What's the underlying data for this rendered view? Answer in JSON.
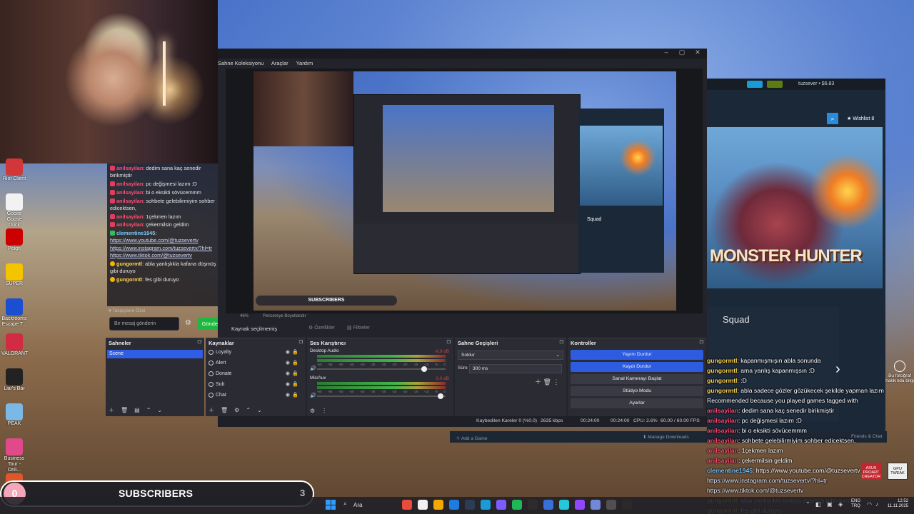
{
  "desktop_icons": [
    {
      "label": "Riot Client",
      "icon": "riot-client-icon",
      "color": "#d13639"
    },
    {
      "label": "Goose Goose Duck",
      "icon": "goose-icon",
      "color": "#f2f2f2"
    },
    {
      "label": "Peign",
      "icon": "peign-icon",
      "color": "#cc0000"
    },
    {
      "label": "SUPER",
      "icon": "super-icon",
      "color": "#f5c400"
    },
    {
      "label": "Backrooms Escape T...",
      "icon": "backrooms-icon",
      "color": "#1a4fd1"
    },
    {
      "label": "VALORANT",
      "icon": "valorant-icon",
      "color": "#d22b43"
    },
    {
      "label": "Liar's Bar",
      "icon": "liars-bar-icon",
      "color": "#222222"
    },
    {
      "label": "PEAK",
      "icon": "peak-icon",
      "color": "#7cb8e6"
    },
    {
      "label": "Business Tour - Onli...",
      "icon": "business-tour-icon",
      "color": "#e04a8a"
    },
    {
      "label": "",
      "icon": "app-icon",
      "color": "#e1552b"
    }
  ],
  "chat_left": {
    "messages": [
      {
        "user": "anilsayilan",
        "role": "user",
        "text": ": dedim sana kaç senedir birikmiştir"
      },
      {
        "user": "anilsayilan",
        "role": "user",
        "text": ": pc değişmesi lazım :D"
      },
      {
        "user": "anilsayilan",
        "role": "user",
        "text": ": bi o eksikti sövücemmm"
      },
      {
        "user": "anilsayilan",
        "role": "user",
        "text": ": sohbete gelebilirmiyim sohber edicektsen,"
      },
      {
        "user": "anilsayilan",
        "role": "user",
        "text": ": 1çekmen lazım"
      },
      {
        "user": "anilsayilan",
        "role": "user",
        "text": ": çekermilsin geldim"
      },
      {
        "user": "clementine1945",
        "role": "bot",
        "text": ":",
        "links": [
          "https://www.youtube.com/@tuzsevertv",
          "https://www.instagram.com/tuzsevertv/?hl=tr",
          "https://www.tiktok.com/@tuzsevertv"
        ]
      },
      {
        "user": "gungormtl",
        "role": "mod",
        "text": ": abla yanlışlıkla kafana düşmüş gibi duruyo"
      },
      {
        "user": "gungormtl",
        "role": "mod",
        "text": ": fes gibi duruyo"
      }
    ],
    "follower_note": "♥ Takipçilere Özel",
    "input_placeholder": "Bir mesaj gönderin",
    "send_label": "Gönder"
  },
  "obs": {
    "menu": [
      "Sahne Koleksiyonu",
      "Araçlar",
      "Yardım"
    ],
    "zoom": "46%",
    "window_projector": "Pencereye Boyutlandır",
    "no_source": "Kaynak seçilmemiş",
    "properties_label": "Özellikler",
    "filters_label": "Filtreler",
    "preview_subscribers": "SUBSCRIBERS",
    "preview_squad": "Squad",
    "docks": {
      "scenes": {
        "title": "Sahneler",
        "items": [
          "Scene"
        ]
      },
      "sources": {
        "title": "Kaynaklar",
        "items": [
          "Loyalty",
          "Alert",
          "Donate",
          "Sub",
          "Chat"
        ]
      },
      "mixer": {
        "title": "Ses Karıştırıcı",
        "channels": [
          {
            "name": "Desktop Audio",
            "db": "-8.9 dB",
            "level": 0.85
          },
          {
            "name": "Mic/Aux",
            "db": "0.0 dB",
            "level": 0.98
          }
        ],
        "ticks": [
          "-60",
          "-55",
          "-50",
          "-45",
          "-40",
          "-35",
          "-30",
          "-25",
          "-20",
          "-15",
          "-10",
          "-5",
          "0"
        ]
      },
      "transitions": {
        "title": "Sahne Geçişleri",
        "type": "Soldur",
        "duration_label": "Süre",
        "duration": "300 ms"
      },
      "controls": {
        "title": "Kontroller",
        "buttons": [
          "Yayını Durdur",
          "Kaydı Durdur",
          "Sanal Kamerayı Başlat",
          "Stüdyo Modu",
          "Ayarlar"
        ]
      }
    },
    "status": {
      "dropped": "Kaybedilen Kareler 0 (%0.0)",
      "bitrate": "2635 kbps",
      "stream_time": "00:24:00",
      "rec_time": "00:24:00",
      "cpu": "CPU: 2.6%",
      "fps": "60.00 / 60.00 FPS"
    }
  },
  "steam": {
    "user": "tuzsever • $6.83",
    "wishlist": "Wishlist",
    "wishlist_count": "8",
    "game_logo": "MONSTER HUNTER",
    "squad_title": "Squad",
    "add_game": "Add a Game",
    "manage_downloads": "Manage Downloads",
    "friends_chat": "Friends & Chat"
  },
  "chat_right": [
    {
      "user": "gungormtl",
      "role": "mod",
      "text": ": kapanmışmışın abla sonunda"
    },
    {
      "user": "gungormtl",
      "role": "mod",
      "text": ": ama yanlış kapanmışsın :D"
    },
    {
      "user": "gungormtl",
      "role": "mod",
      "text": ": :D"
    },
    {
      "user": "gungormtl",
      "role": "mod",
      "text": ": abla sadece gözler gözükecek şekilde yapman lazım"
    },
    {
      "user": "",
      "role": "none",
      "text": "Recommended because you played games tagged with"
    },
    {
      "user": "anilsayilan",
      "role": "user",
      "text": ": dedim sana kaç senedir birikmiştir"
    },
    {
      "user": "anilsayilan",
      "role": "user",
      "text": ": pc değişmesi lazım :D"
    },
    {
      "user": "anilsayilan",
      "role": "user",
      "text": ": bi o eksikti sövücemmm"
    },
    {
      "user": "anilsayilan",
      "role": "user",
      "text": ": sohbete gelebilirmiyim sohber edicektsen,"
    },
    {
      "user": "anilsayilan",
      "role": "user",
      "text": ": 1çekmen lazım"
    },
    {
      "user": "anilsayilan",
      "role": "user",
      "text": ": çekermilsin geldim"
    },
    {
      "user": "clementine1945",
      "role": "bot",
      "text": ": https://www.youtube.com/@tuzsevertv"
    },
    {
      "user": "",
      "role": "link",
      "text": "https://www.instagram.com/tuzsevertv/?hl=tr"
    },
    {
      "user": "",
      "role": "link",
      "text": "https://www.tiktok.com/@tuzsevertv"
    },
    {
      "user": "gungormtl",
      "role": "mod",
      "text": ": abla yanlışlıkla kafana düşmüş gibi duruyo"
    },
    {
      "user": "gungormtl",
      "role": "mod",
      "text": ": fes gibi duruyo"
    }
  ],
  "desktop_right": {
    "foto_label": "Bu fotoğraf hakkında bilgi",
    "asus1": "ASUS PROART CREATOR",
    "asus2": "GPU TWEAK"
  },
  "subscribers_bar": {
    "count": "0",
    "label": "SUBSCRIBERS",
    "goal": "3"
  },
  "taskbar": {
    "search": "Ara",
    "lang_top": "ENG",
    "lang_bottom": "TRQ",
    "time": "12:52",
    "date": "11.11.2025",
    "app_colors": [
      "#e94b3c",
      "#f0f0f0",
      "#f2a900",
      "#1e7be0",
      "#2b3d55",
      "#1a9bd7",
      "#7b5cff",
      "#1db954",
      "#2c2c2c",
      "#3b6fd8",
      "#24c8db",
      "#9146ff",
      "#7289da",
      "#505050",
      "#2a2a2a"
    ],
    "accent": "#2f9bff"
  }
}
